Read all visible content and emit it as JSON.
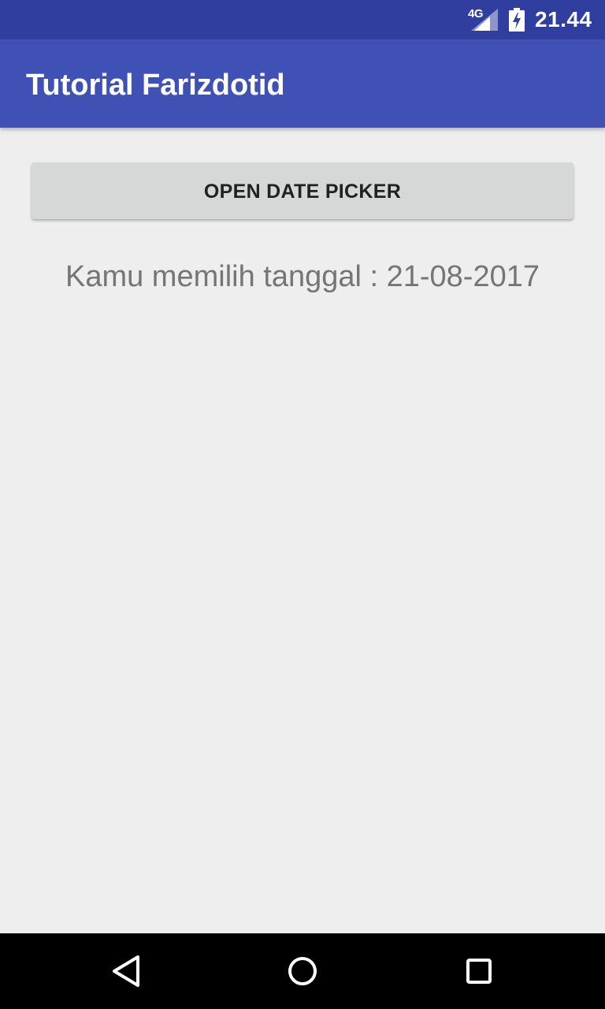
{
  "status_bar": {
    "network": "4G",
    "time": "21.44",
    "icons": [
      "signal-icon",
      "battery-charging-icon"
    ]
  },
  "app_bar": {
    "title": "Tutorial Farizdotid"
  },
  "content": {
    "open_button_label": "OPEN DATE PICKER",
    "result_text": "Kamu memilih tanggal : 21-08-2017"
  },
  "nav_bar": {
    "icons": [
      "back-icon",
      "home-icon",
      "recents-icon"
    ]
  },
  "colors": {
    "status_bar": "#303f9f",
    "app_bar": "#3f51b5",
    "background": "#eeeeee",
    "button": "#d6d7d7",
    "button_text": "#212121",
    "result_text": "#757575",
    "nav_bar": "#000000"
  }
}
